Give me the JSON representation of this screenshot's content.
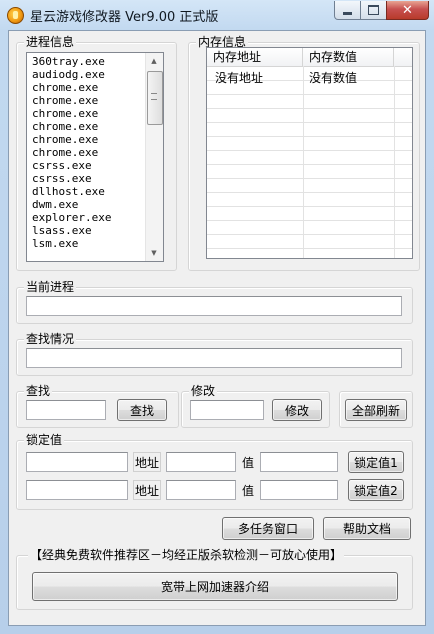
{
  "window": {
    "title": "星云游戏修改器 Ver9.00 正式版",
    "close_glyph": "✕"
  },
  "process_info": {
    "label": "进程信息",
    "items": [
      "360tray.exe",
      "audiodg.exe",
      "chrome.exe",
      "chrome.exe",
      "chrome.exe",
      "chrome.exe",
      "chrome.exe",
      "chrome.exe",
      "csrss.exe",
      "csrss.exe",
      "dllhost.exe",
      "dwm.exe",
      "explorer.exe",
      "lsass.exe",
      "lsm.exe"
    ]
  },
  "memory_info": {
    "label": "内存信息",
    "columns": [
      "内存地址",
      "内存数值"
    ],
    "row": [
      "没有地址",
      "没有数值"
    ]
  },
  "current_process": {
    "label": "当前进程",
    "value": ""
  },
  "search_status": {
    "label": "查找情况",
    "value": ""
  },
  "search": {
    "label": "查找",
    "input": "",
    "button": "查找"
  },
  "modify": {
    "label": "修改",
    "input": "",
    "button": "修改"
  },
  "refresh_all_button": "全部刷新",
  "lock": {
    "label": "锁定值",
    "address_label": "地址",
    "value_label": "值",
    "rows": [
      {
        "button": "锁定值1"
      },
      {
        "button": "锁定值2"
      }
    ]
  },
  "multitask_button": "多任务窗口",
  "help_button": "帮助文档",
  "recommend": {
    "label": "【经典免费软件推荐区－均经正版杀软检测－可放心使用】",
    "button": "宽带上网加速器介绍"
  }
}
